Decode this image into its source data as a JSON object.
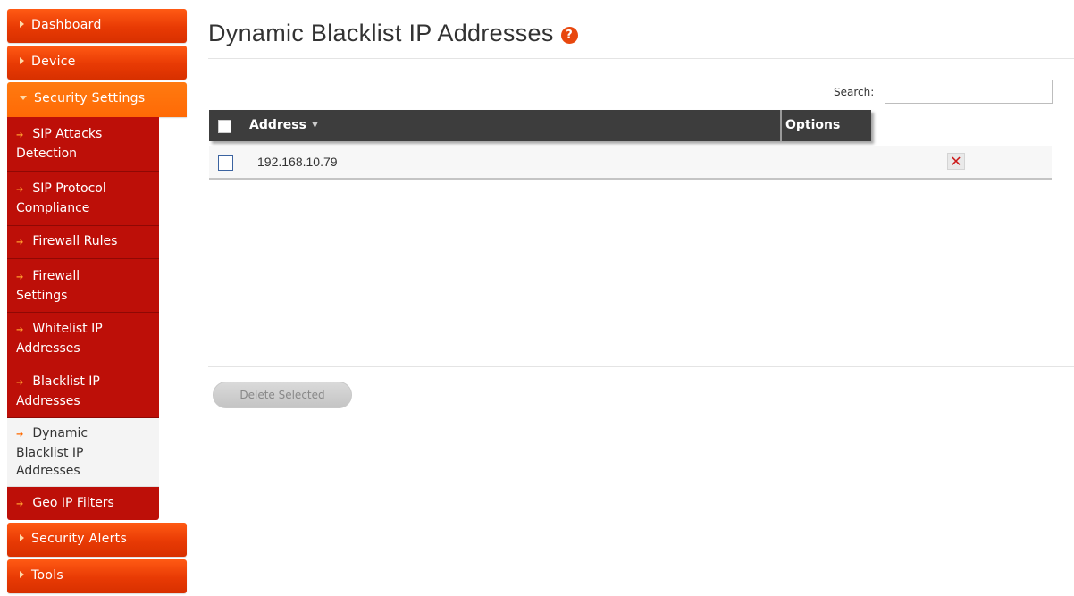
{
  "sidebar": {
    "top_items": [
      {
        "label": "Dashboard"
      },
      {
        "label": "Device"
      },
      {
        "label": "Security Settings"
      }
    ],
    "sub_items": [
      {
        "lines": [
          "SIP Attacks",
          "Detection"
        ]
      },
      {
        "lines": [
          "SIP Protocol",
          "Compliance"
        ]
      },
      {
        "lines": [
          "Firewall Rules"
        ]
      },
      {
        "lines": [
          "Firewall",
          "Settings"
        ]
      },
      {
        "lines": [
          "Whitelist IP",
          "Addresses"
        ]
      },
      {
        "lines": [
          "Blacklist IP",
          "Addresses"
        ]
      },
      {
        "lines": [
          "Dynamic",
          "Blacklist IP",
          "Addresses"
        ]
      },
      {
        "lines": [
          "Geo IP Filters"
        ]
      }
    ],
    "bottom_items": [
      {
        "label": "Security Alerts"
      },
      {
        "label": "Tools"
      }
    ]
  },
  "page": {
    "title": "Dynamic Blacklist IP Addresses",
    "help_icon": "?"
  },
  "search": {
    "label": "Search:",
    "value": ""
  },
  "table": {
    "columns": [
      "Address",
      "Options"
    ],
    "rows": [
      {
        "address": "192.168.10.79",
        "delete_icon": "✕"
      }
    ]
  },
  "actions": {
    "delete_selected": "Delete Selected"
  },
  "colors": {
    "menu_orange": "#e83a04",
    "menu_open": "#ff6a06",
    "submenu_red": "#bd0f08",
    "header_dark": "#3d3d3d"
  }
}
